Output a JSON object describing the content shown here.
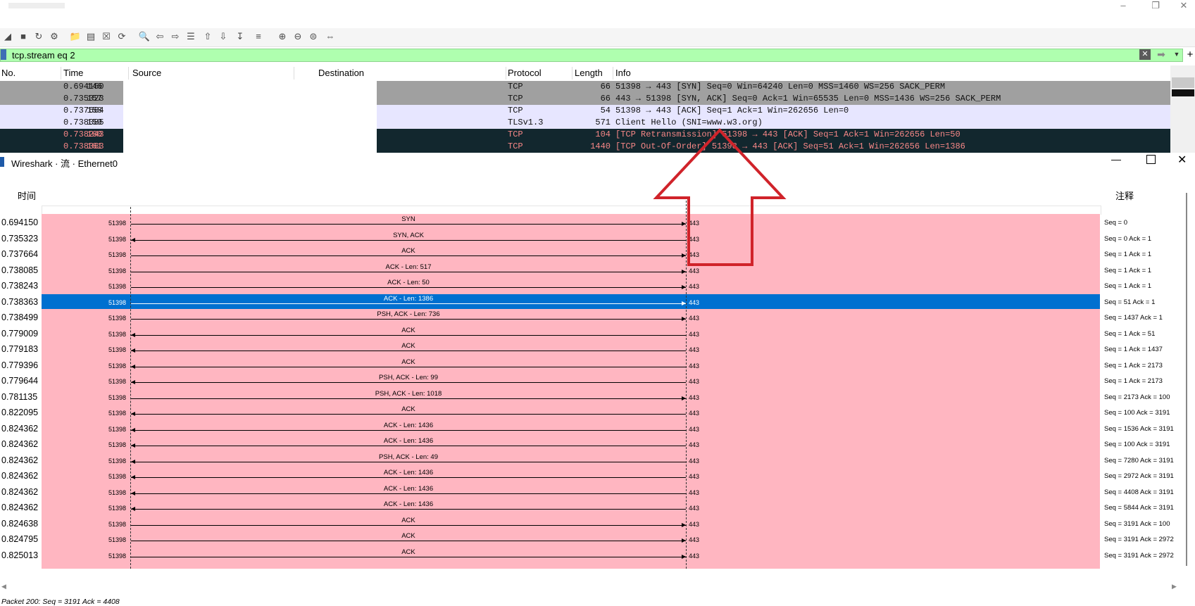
{
  "main": {
    "toolbar_icons": [
      "shark-fin-icon",
      "stop-icon",
      "restart-icon",
      "options-gear-icon",
      "open-folder-icon",
      "save-file-icon",
      "close-file-icon",
      "reload-icon",
      "find-icon",
      "back-arrow-icon",
      "forward-arrow-icon",
      "goto-packet-icon",
      "first-packet-icon",
      "last-packet-icon",
      "autoscroll-icon",
      "colorize-icon",
      "zoom-in-icon",
      "zoom-out-icon",
      "zoom-reset-icon",
      "resize-columns-icon"
    ]
  },
  "filter": {
    "value": "tcp.stream eq 2",
    "bg_color": "#afffaf"
  },
  "packet_list": {
    "columns": [
      "No.",
      "Time",
      "Source",
      "Destination",
      "Protocol",
      "Length",
      "Info"
    ],
    "rows": [
      {
        "no": "146",
        "time": "0.694150",
        "protocol": "TCP",
        "length": "66",
        "info": "51398 → 443 [SYN] Seq=0 Win=64240 Len=0 MSS=1460 WS=256 SACK_PERM",
        "bg": "#a0a0a0",
        "fg": "#111111"
      },
      {
        "no": "157",
        "time": "0.735323",
        "protocol": "TCP",
        "length": "66",
        "info": "443 → 51398 [SYN, ACK] Seq=0 Ack=1 Win=65535 Len=0 MSS=1436 WS=256 SACK_PERM",
        "bg": "#a0a0a0",
        "fg": "#111111"
      },
      {
        "no": "158",
        "time": "0.737664",
        "protocol": "TCP",
        "length": "54",
        "info": "51398 → 443 [ACK] Seq=1 Ack=1 Win=262656 Len=0",
        "bg": "#e7e6ff",
        "fg": "#111111"
      },
      {
        "no": "159",
        "time": "0.738085",
        "protocol": "TLSv1.3",
        "length": "571",
        "info": "Client Hello (SNI=www.w3.org)",
        "bg": "#e7e6ff",
        "fg": "#111111"
      },
      {
        "no": "160",
        "time": "0.738243",
        "protocol": "TCP",
        "length": "104",
        "info": "[TCP Retransmission] 51398 → 443 [ACK] Seq=1 Ack=1 Win=262656 Len=50",
        "bg": "#12272e",
        "fg": "#f78787"
      },
      {
        "no": "161",
        "time": "0.738363",
        "protocol": "TCP",
        "length": "1440",
        "info": "[TCP Out-Of-Order] 51398 → 443 [ACK] Seq=51 Ack=1 Win=262656 Len=1386",
        "bg": "#12272e",
        "fg": "#f78787"
      }
    ]
  },
  "flow_window": {
    "title": "Wireshark · 流 · Ethernet0",
    "header_time": "时间",
    "header_note": "注释",
    "row_color": "#ffb6c1",
    "selected_color": "#0070d0",
    "left_port": "51398",
    "right_port": "443",
    "rows": [
      {
        "time": "0.694150",
        "label": "SYN",
        "dir": "right",
        "note": "Seq = 0"
      },
      {
        "time": "0.735323",
        "label": "SYN, ACK",
        "dir": "left",
        "note": "Seq = 0 Ack = 1"
      },
      {
        "time": "0.737664",
        "label": "ACK",
        "dir": "right",
        "note": "Seq = 1 Ack = 1"
      },
      {
        "time": "0.738085",
        "label": "ACK - Len: 517",
        "dir": "right",
        "note": "Seq = 1 Ack = 1"
      },
      {
        "time": "0.738243",
        "label": "ACK - Len: 50",
        "dir": "right",
        "note": "Seq = 1 Ack = 1"
      },
      {
        "time": "0.738363",
        "label": "ACK - Len: 1386",
        "dir": "right",
        "note": "Seq = 51 Ack = 1",
        "selected": true
      },
      {
        "time": "0.738499",
        "label": "PSH, ACK - Len: 736",
        "dir": "right",
        "note": "Seq = 1437 Ack = 1"
      },
      {
        "time": "0.779009",
        "label": "ACK",
        "dir": "left",
        "note": "Seq = 1 Ack = 51"
      },
      {
        "time": "0.779183",
        "label": "ACK",
        "dir": "left",
        "note": "Seq = 1 Ack = 1437"
      },
      {
        "time": "0.779396",
        "label": "ACK",
        "dir": "left",
        "note": "Seq = 1 Ack = 2173"
      },
      {
        "time": "0.779644",
        "label": "PSH, ACK - Len: 99",
        "dir": "left",
        "note": "Seq = 1 Ack = 2173"
      },
      {
        "time": "0.781135",
        "label": "PSH, ACK - Len: 1018",
        "dir": "right",
        "note": "Seq = 2173 Ack = 100"
      },
      {
        "time": "0.822095",
        "label": "ACK",
        "dir": "left",
        "note": "Seq = 100 Ack = 3191"
      },
      {
        "time": "0.824362",
        "label": "ACK - Len: 1436",
        "dir": "left",
        "note": "Seq = 1536 Ack = 3191"
      },
      {
        "time": "0.824362",
        "label": "ACK - Len: 1436",
        "dir": "left",
        "note": "Seq = 100 Ack = 3191"
      },
      {
        "time": "0.824362",
        "label": "PSH, ACK - Len: 49",
        "dir": "left",
        "note": "Seq = 7280 Ack = 3191"
      },
      {
        "time": "0.824362",
        "label": "ACK - Len: 1436",
        "dir": "left",
        "note": "Seq = 2972 Ack = 3191"
      },
      {
        "time": "0.824362",
        "label": "ACK - Len: 1436",
        "dir": "left",
        "note": "Seq = 4408 Ack = 3191"
      },
      {
        "time": "0.824362",
        "label": "ACK - Len: 1436",
        "dir": "left",
        "note": "Seq = 5844 Ack = 3191"
      },
      {
        "time": "0.824638",
        "label": "ACK",
        "dir": "right",
        "note": "Seq = 3191 Ack = 100"
      },
      {
        "time": "0.824795",
        "label": "ACK",
        "dir": "right",
        "note": "Seq = 3191 Ack = 2972"
      },
      {
        "time": "0.825013",
        "label": "ACK",
        "dir": "right",
        "note": "Seq = 3191 Ack = 2972"
      }
    ],
    "status": "Packet 200: Seq = 3191 Ack = 4408"
  },
  "annotation": {
    "arrow_color": "#d0232a",
    "icon": "red-up-arrow-annotation"
  }
}
